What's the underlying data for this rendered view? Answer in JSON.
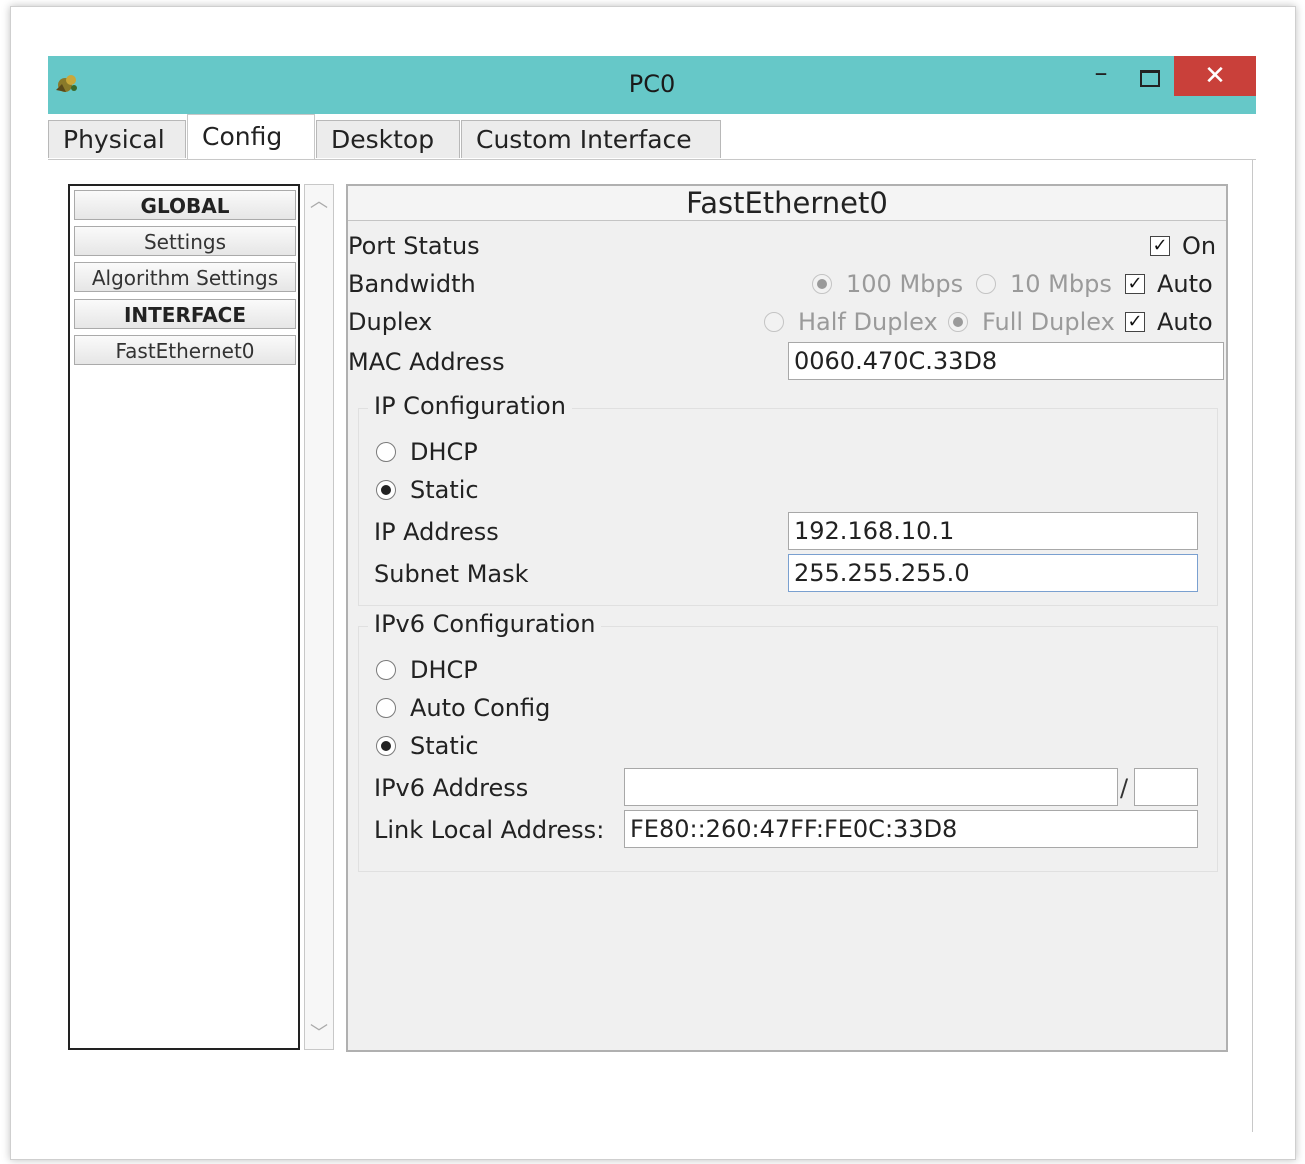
{
  "window": {
    "title": "PC0",
    "min_glyph": "–",
    "close_glyph": "✕",
    "accent": "#66c8c8",
    "close_color": "#c9403a"
  },
  "tabs": [
    {
      "label": "Physical",
      "active": false
    },
    {
      "label": "Config",
      "active": true
    },
    {
      "label": "Desktop",
      "active": false
    },
    {
      "label": "Custom Interface",
      "active": false
    }
  ],
  "sidebar": {
    "items": [
      {
        "label": "GLOBAL",
        "header": true
      },
      {
        "label": "Settings",
        "header": false
      },
      {
        "label": "Algorithm Settings",
        "header": false
      },
      {
        "label": "INTERFACE",
        "header": true
      },
      {
        "label": "FastEthernet0",
        "header": false
      }
    ],
    "scroll_up": "︿",
    "scroll_down": "﹀"
  },
  "panel": {
    "title": "FastEthernet0",
    "port_status": {
      "label": "Port Status",
      "on_label": "On",
      "on": true
    },
    "bandwidth": {
      "label": "Bandwidth",
      "opt1": "100 Mbps",
      "opt1_selected": true,
      "opt2": "10 Mbps",
      "opt2_selected": false,
      "auto_label": "Auto",
      "auto": true
    },
    "duplex": {
      "label": "Duplex",
      "opt1": "Half Duplex",
      "opt1_selected": false,
      "opt2": "Full Duplex",
      "opt2_selected": true,
      "auto_label": "Auto",
      "auto": true
    },
    "mac": {
      "label": "MAC Address",
      "value": "0060.470C.33D8"
    },
    "ip_config": {
      "title": "IP Configuration",
      "dhcp_label": "DHCP",
      "dhcp": false,
      "static_label": "Static",
      "static": true,
      "ip_label": "IP Address",
      "ip_value": "192.168.10.1",
      "mask_label": "Subnet Mask",
      "mask_value": "255.255.255.0"
    },
    "ipv6_config": {
      "title": "IPv6 Configuration",
      "dhcp_label": "DHCP",
      "dhcp": false,
      "auto_label": "Auto Config",
      "auto": false,
      "static_label": "Static",
      "static": true,
      "addr_label": "IPv6 Address",
      "addr_value": "",
      "prefix_value": "",
      "slash": "/",
      "link_local_label": "Link Local Address:",
      "link_local_value": "FE80::260:47FF:FE0C:33D8"
    }
  }
}
